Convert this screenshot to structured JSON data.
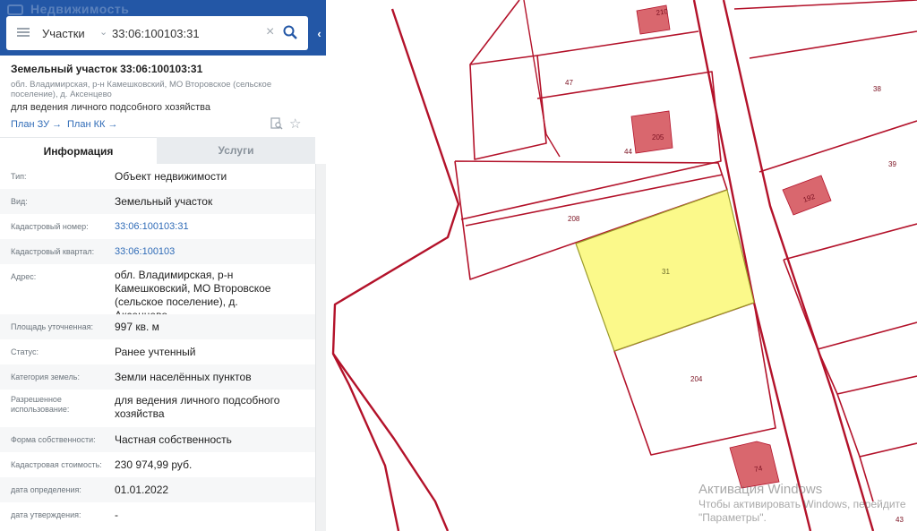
{
  "header": {
    "brand": "Недвижимость",
    "search_type": "Участки",
    "search_value": "33:06:100103:31"
  },
  "object": {
    "title": "Земельный участок 33:06:100103:31",
    "address": "обл. Владимирская, р-н Камешковский, МО Второвское (сельское поселение), д. Аксенцево",
    "purpose": "для ведения личного подсобного хозяйства",
    "plan_zu": "План ЗУ →",
    "plan_kk": "План КК →"
  },
  "tabs": {
    "info": "Информация",
    "services": "Услуги"
  },
  "info": [
    {
      "label": "Тип:",
      "value": "Объект недвижимости"
    },
    {
      "label": "Вид:",
      "value": "Земельный участок"
    },
    {
      "label": "Кадастровый номер:",
      "value": "33:06:100103:31"
    },
    {
      "label": "Кадастровый квартал:",
      "value": "33:06:100103"
    },
    {
      "label": "Адрес:",
      "value": "обл. Владимирская, р-н Камешковский, МО Второвское (сельское поселение), д. Аксенцево"
    },
    {
      "label": "Площадь уточненная:",
      "value": "997 кв. м"
    },
    {
      "label": "Статус:",
      "value": "Ранее учтенный"
    },
    {
      "label": "Категория земель:",
      "value": "Земли населённых пунктов"
    },
    {
      "label": "Разрешенное использование:",
      "value": "для ведения личного подсобного хозяйства"
    },
    {
      "label": "Форма собственности:",
      "value": "Частная собственность"
    },
    {
      "label": "Кадастровая стоимость:",
      "value": "230 974,99 руб."
    },
    {
      "label": "дата определения:",
      "value": "01.01.2022"
    },
    {
      "label": "дата утверждения:",
      "value": "-"
    }
  ],
  "map": {
    "parcels": [
      "210",
      "47",
      "38",
      "205",
      "44",
      "39",
      "192",
      "208",
      "31",
      "204",
      "74",
      "43"
    ],
    "selected_parcel": "31",
    "colors": {
      "boundary": "#b3122a",
      "selected_fill": "#fbf98a",
      "building": "#d9676e"
    }
  },
  "watermark": {
    "title": "Активация Windows",
    "line1": "Чтобы активировать Windows, перейдите",
    "line2": "\"Параметры\"."
  }
}
